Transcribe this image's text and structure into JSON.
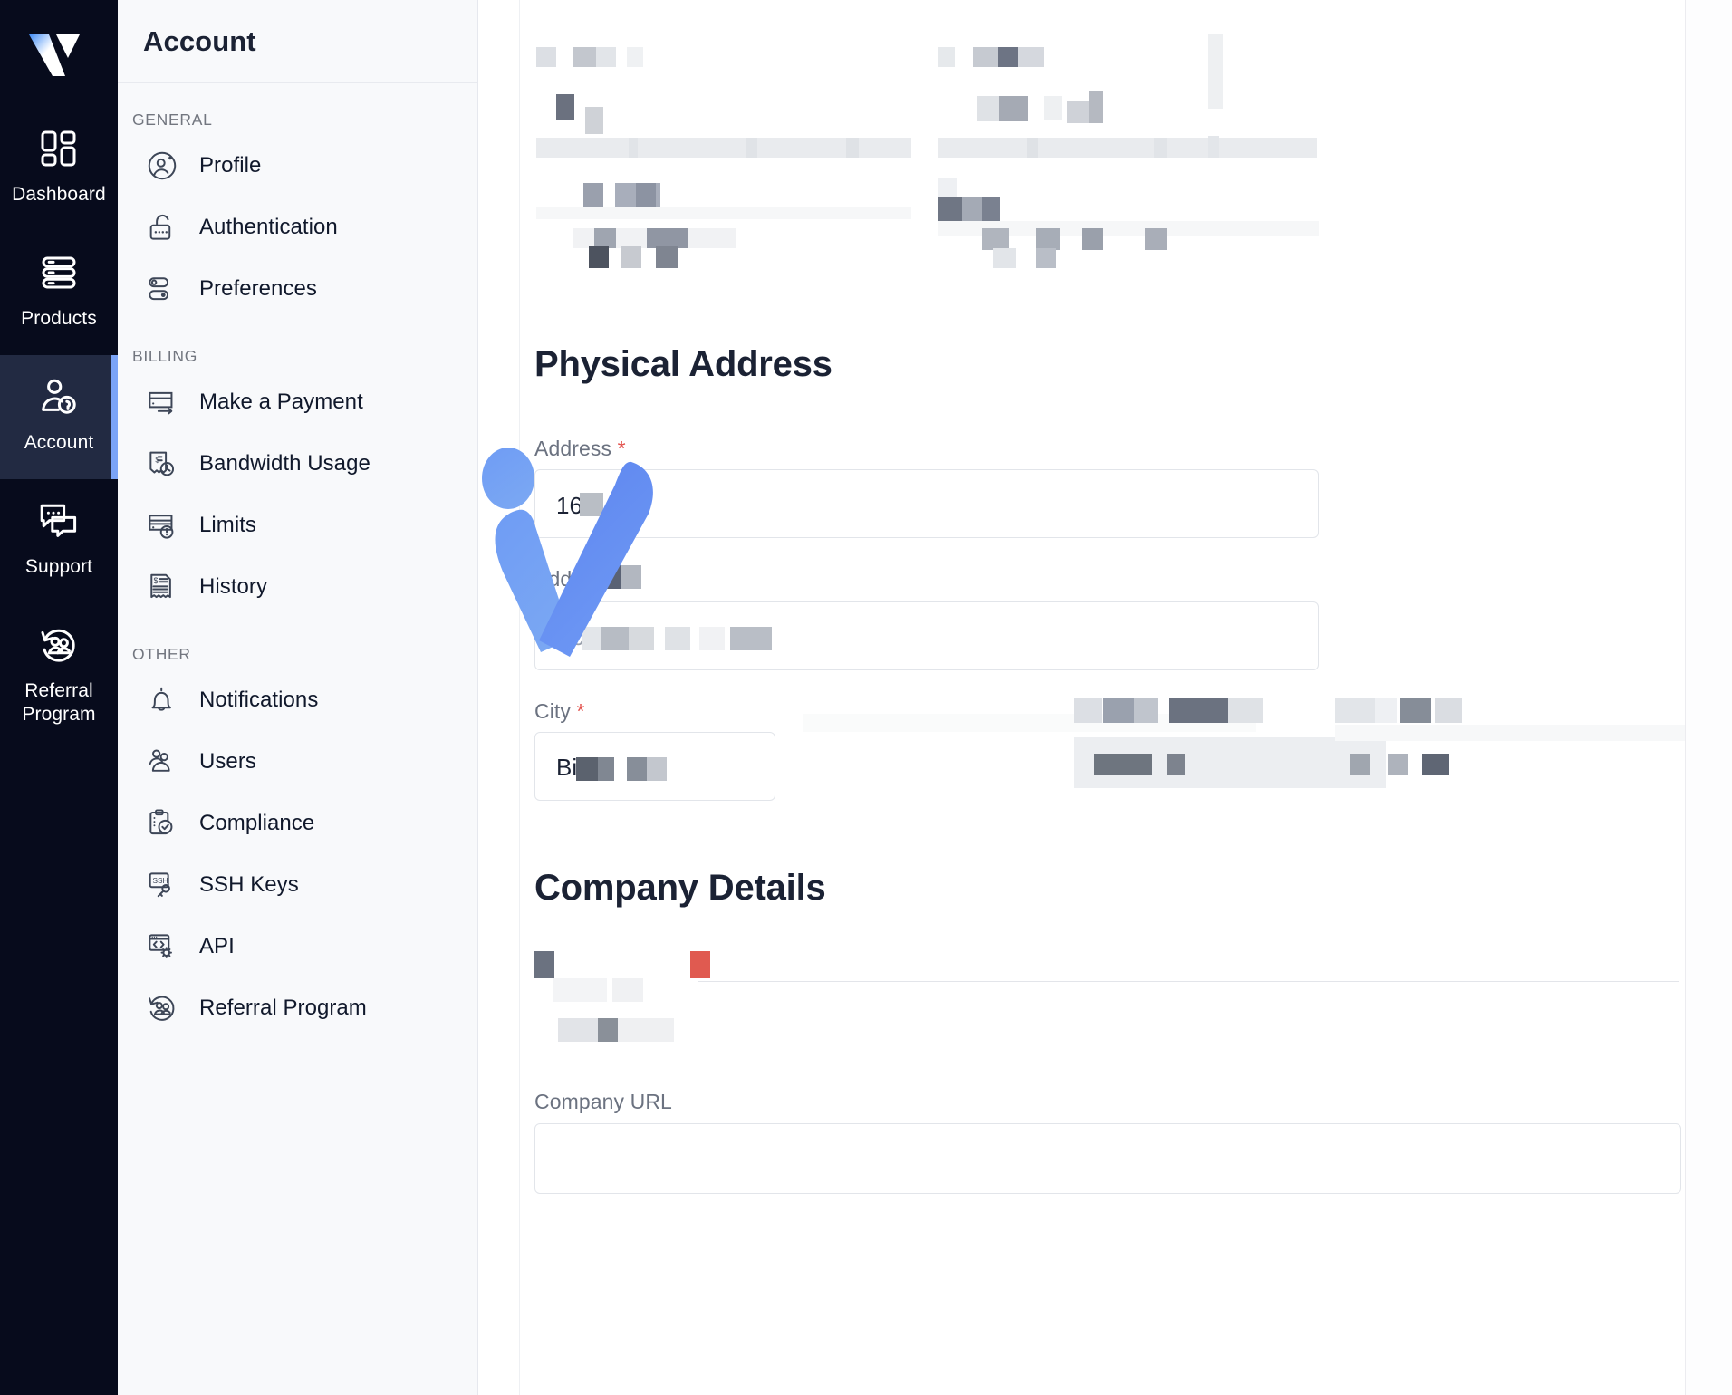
{
  "brand": {
    "logo_name": "vultr-logo",
    "accent": "#4a7cf5",
    "rail_bg": "#070b1c",
    "active_bg": "#222a42",
    "indicator": "#7ba4f7"
  },
  "rail": {
    "items": [
      {
        "label": "Dashboard",
        "icon": "dashboard-grid-icon",
        "active": false
      },
      {
        "label": "Products",
        "icon": "servers-stack-icon",
        "active": false
      },
      {
        "label": "Account",
        "icon": "user-key-icon",
        "active": true
      },
      {
        "label": "Support",
        "icon": "chat-bubbles-icon",
        "active": false
      },
      {
        "label": "Referral Program",
        "icon": "referral-people-icon",
        "active": false
      }
    ]
  },
  "sidebar": {
    "title": "Account",
    "groups": [
      {
        "label": "GENERAL",
        "items": [
          {
            "label": "Profile",
            "icon": "user-circle-icon"
          },
          {
            "label": "Authentication",
            "icon": "unlocked-padlock-icon"
          },
          {
            "label": "Preferences",
            "icon": "toggles-icon"
          }
        ]
      },
      {
        "label": "BILLING",
        "items": [
          {
            "label": "Make a Payment",
            "icon": "credit-card-arrow-icon"
          },
          {
            "label": "Bandwidth Usage",
            "icon": "bandwidth-gauge-icon"
          },
          {
            "label": "Limits",
            "icon": "card-alert-icon"
          },
          {
            "label": "History",
            "icon": "receipt-icon"
          }
        ]
      },
      {
        "label": "OTHER",
        "items": [
          {
            "label": "Notifications",
            "icon": "bell-icon"
          },
          {
            "label": "Users",
            "icon": "users-group-icon"
          },
          {
            "label": "Compliance",
            "icon": "clipboard-check-icon"
          },
          {
            "label": "SSH Keys",
            "icon": "ssh-key-icon"
          },
          {
            "label": "API",
            "icon": "code-gear-icon"
          },
          {
            "label": "Referral Program",
            "icon": "referral-people-icon"
          }
        ]
      }
    ]
  },
  "main": {
    "sections": [
      {
        "id": "physical_address",
        "title": "Physical Address"
      },
      {
        "id": "company_details",
        "title": "Company Details"
      }
    ],
    "physical_address": {
      "fields": [
        {
          "label": "Address",
          "required": true,
          "value": "16",
          "value_redacted": true
        },
        {
          "label": "Addr",
          "label_truncated": true,
          "required": false,
          "placeholder": "Ac",
          "placeholder_redacted": true
        },
        {
          "label": "City",
          "required": true,
          "value": "Bi",
          "value_redacted": true
        }
      ]
    },
    "company_details": {
      "fields": [
        {
          "label": "",
          "label_redacted": true,
          "required": true,
          "value": "",
          "value_redacted": true
        },
        {
          "label": "Company URL",
          "required": false,
          "value": "",
          "value_redacted": false
        }
      ]
    },
    "redacted_note": "upper form fields obscured"
  },
  "overlay": {
    "name": "vultr-v-cursor",
    "color_light": "#7aa3f2",
    "color_dark": "#5b82ee"
  }
}
